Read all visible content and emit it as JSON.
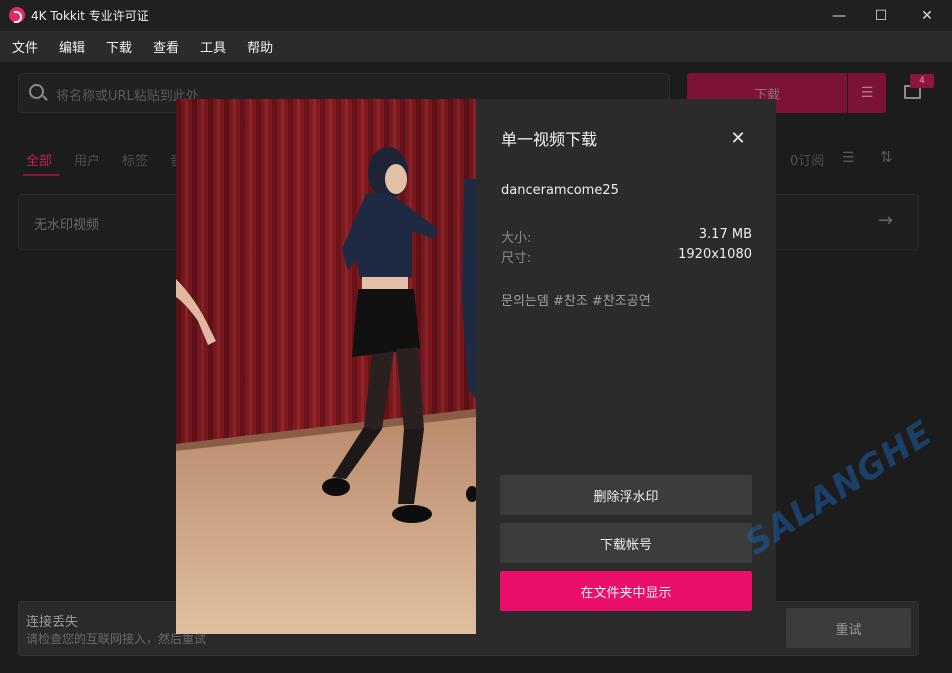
{
  "window": {
    "title": "4K Tokkit 专业许可证",
    "minimize": "—",
    "maximize": "☐",
    "close": "✕"
  },
  "menu": [
    "文件",
    "编辑",
    "下载",
    "查看",
    "工具",
    "帮助"
  ],
  "search": {
    "placeholder": "将名称或URL粘贴到此处",
    "download_label": "下载",
    "badge_count": "4"
  },
  "tabs": {
    "all": "全部",
    "users": "用户",
    "tags": "标签",
    "partial": "音",
    "subscriptions": "0订阅"
  },
  "rows": {
    "no_watermark": "无水印视频"
  },
  "error": {
    "title": "连接丢失",
    "description": "请检查您的互联网接入，然后重试",
    "retry": "重试"
  },
  "dialog": {
    "title": "单一视频下载",
    "close": "✕",
    "username": "danceramcome25",
    "size_label": "大小:",
    "size_value": "3.17 MB",
    "dimensions_label": "尺寸:",
    "dimensions_value": "1920x1080",
    "tags": "문의는뎀 #찬조 #찬조공연",
    "remove_watermark": "删除浮水印",
    "download_account": "下载帐号",
    "show_in_folder": "在文件夹中显示"
  },
  "overlay_watermark": "SALANGHE",
  "colors": {
    "accent": "#ea0f6b",
    "dialog_bg": "#2b2b2b",
    "button_bg": "#3c3c3c"
  }
}
